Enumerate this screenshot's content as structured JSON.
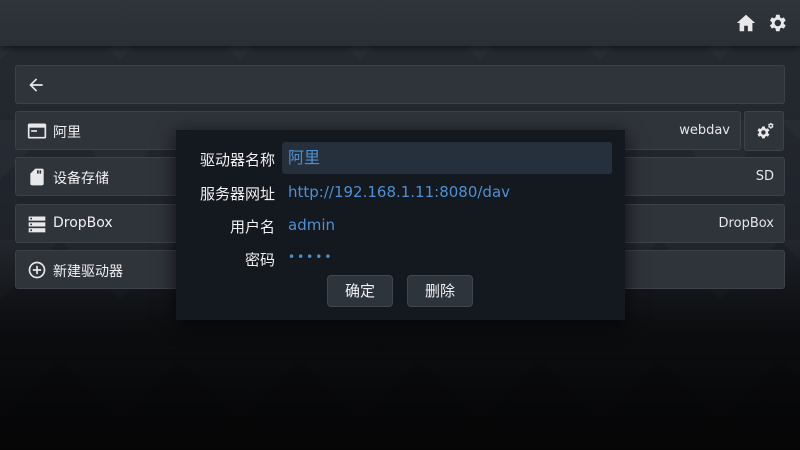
{
  "topbar": {
    "home_icon": "home-icon",
    "settings_icon": "gear-icon"
  },
  "nav": {
    "back_icon": "arrow-back-icon"
  },
  "drives": [
    {
      "label": "阿里",
      "type": "webdav",
      "icon": "window-icon"
    },
    {
      "label": "设备存储",
      "type": "SD",
      "icon": "sd-card-icon"
    },
    {
      "label": "DropBox",
      "type": "DropBox",
      "icon": "server-icon"
    }
  ],
  "add_drive": {
    "label": "新建驱动器",
    "icon": "add-circle-icon"
  },
  "drive_settings_icon": "gear-settings-icon",
  "dialog": {
    "name_label": "驱动器名称",
    "name_value": "阿里",
    "url_label": "服务器网址",
    "url_value": "http://192.168.1.11:8080/dav",
    "user_label": "用户名",
    "user_value": "admin",
    "password_label": "密码",
    "password_value": "•••••",
    "confirm_label": "确定",
    "delete_label": "删除"
  },
  "colors": {
    "accent": "#4f8fd2",
    "dialog_bg": "#14181f",
    "row_bg": "#2f333a"
  }
}
